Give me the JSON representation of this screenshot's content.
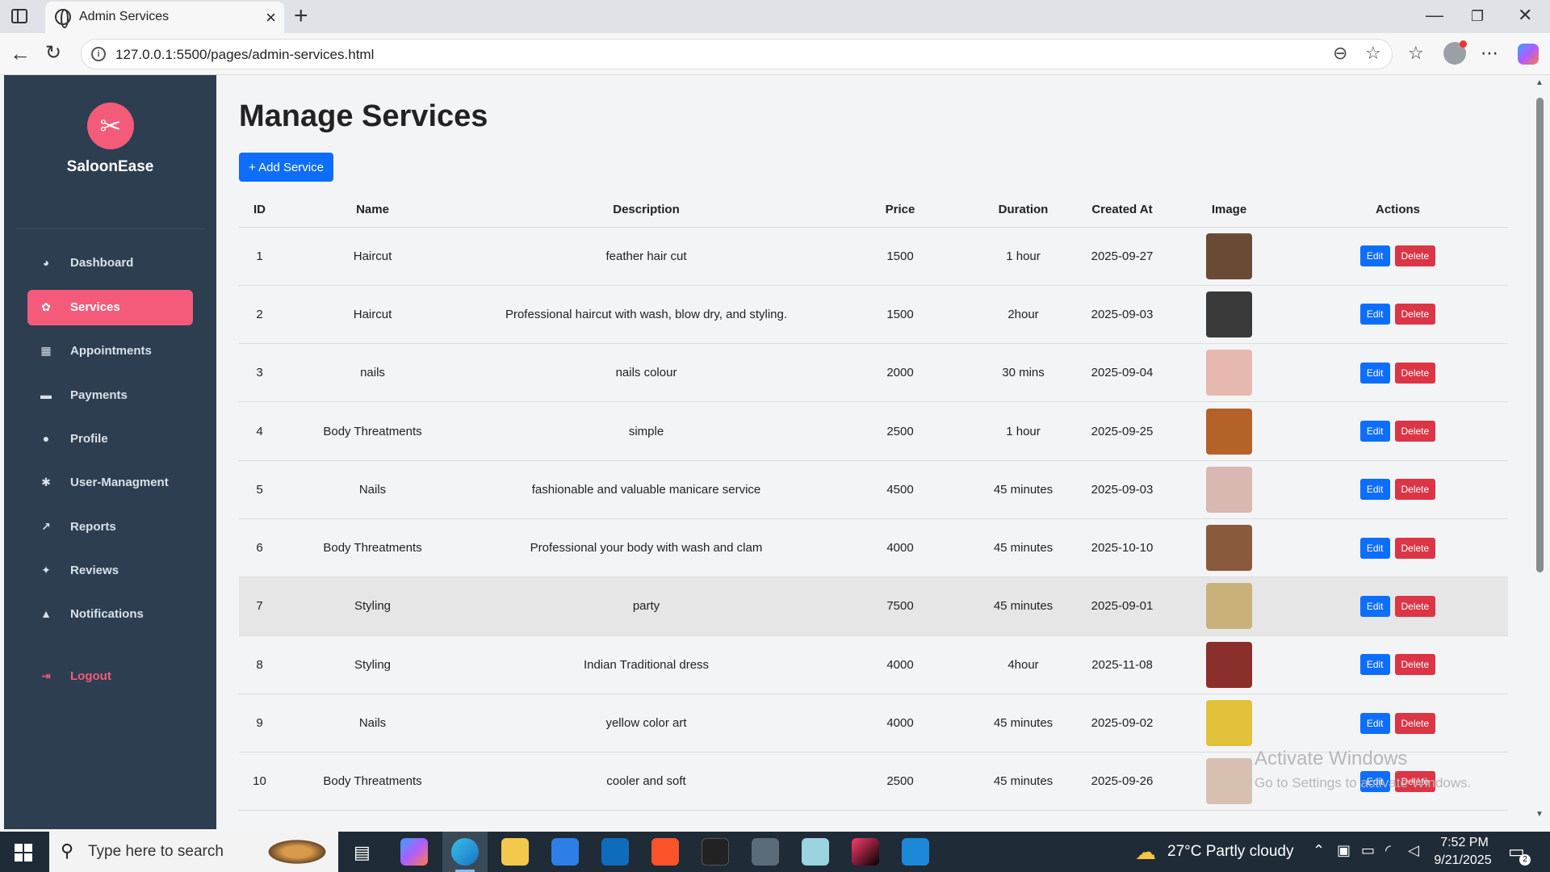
{
  "browser": {
    "tab_title": "Admin Services",
    "url": "127.0.0.1:5500/pages/admin-services.html"
  },
  "sidebar": {
    "brand": "SaloonEase",
    "items": [
      {
        "label": "Dashboard",
        "icon": "dashboard-icon",
        "glyph": "◕"
      },
      {
        "label": "Services",
        "icon": "scissors-icon",
        "glyph": "✿",
        "active": true
      },
      {
        "label": "Appointments",
        "icon": "calendar-icon",
        "glyph": "▦"
      },
      {
        "label": "Payments",
        "icon": "credit-card-icon",
        "glyph": "▬"
      },
      {
        "label": "Profile",
        "icon": "user-icon",
        "glyph": "●"
      },
      {
        "label": "User-Managment",
        "icon": "gear-icon",
        "glyph": "✱"
      },
      {
        "label": "Reports",
        "icon": "chart-icon",
        "glyph": "↗"
      },
      {
        "label": "Reviews",
        "icon": "users-icon",
        "glyph": "✦"
      },
      {
        "label": "Notifications",
        "icon": "bell-icon",
        "glyph": "▲"
      }
    ],
    "logout": "Logout"
  },
  "main": {
    "title": "Manage Services",
    "add_button": "+ Add Service",
    "columns": [
      "ID",
      "Name",
      "Description",
      "Price",
      "Duration",
      "Created At",
      "Image",
      "Actions"
    ],
    "rows": [
      {
        "id": "1",
        "name": "Haircut",
        "description": "feather hair cut",
        "price": "1500",
        "duration": "1 hour",
        "created_at": "2025-09-27",
        "thumb_color": "#6b4a35"
      },
      {
        "id": "2",
        "name": "Haircut",
        "description": "Professional haircut with wash, blow dry, and styling.",
        "price": "1500",
        "duration": "2hour",
        "created_at": "2025-09-03",
        "thumb_color": "#3a3a3a"
      },
      {
        "id": "3",
        "name": "nails",
        "description": "nails colour",
        "price": "2000",
        "duration": "30 mins",
        "created_at": "2025-09-04",
        "thumb_color": "#e6b8b0"
      },
      {
        "id": "4",
        "name": "Body Threatments",
        "description": "simple",
        "price": "2500",
        "duration": "1 hour",
        "created_at": "2025-09-25",
        "thumb_color": "#b5612a"
      },
      {
        "id": "5",
        "name": "Nails",
        "description": "fashionable and valuable manicare service",
        "price": "4500",
        "duration": "45 minutes",
        "created_at": "2025-09-03",
        "thumb_color": "#d9b8b2"
      },
      {
        "id": "6",
        "name": "Body Threatments",
        "description": "Professional your body with wash and clam",
        "price": "4000",
        "duration": "45 minutes",
        "created_at": "2025-10-10",
        "thumb_color": "#8a5a3c"
      },
      {
        "id": "7",
        "name": "Styling",
        "description": "party",
        "price": "7500",
        "duration": "45 minutes",
        "created_at": "2025-09-01",
        "thumb_color": "#c9b27a",
        "highlight": true
      },
      {
        "id": "8",
        "name": "Styling",
        "description": "Indian Traditional dress",
        "price": "4000",
        "duration": "4hour",
        "created_at": "2025-11-08",
        "thumb_color": "#8a2f2a"
      },
      {
        "id": "9",
        "name": "Nails",
        "description": "yellow color art",
        "price": "4000",
        "duration": "45 minutes",
        "created_at": "2025-09-02",
        "thumb_color": "#e2c23a"
      },
      {
        "id": "10",
        "name": "Body Threatments",
        "description": "cooler and soft",
        "price": "2500",
        "duration": "45 minutes",
        "created_at": "2025-09-26",
        "thumb_color": "#d8c0b0"
      }
    ],
    "edit_label": "Edit",
    "delete_label": "Delete"
  },
  "watermark": {
    "line1": "Activate Windows",
    "line2": "Go to Settings to activate Windows."
  },
  "taskbar": {
    "search_placeholder": "Type here to search",
    "weather": "27°C  Partly cloudy",
    "time": "7:52 PM",
    "date": "9/21/2025",
    "notification_count": "2"
  },
  "colors": {
    "sidebar_bg": "#2c3e50",
    "accent_pink": "#f45b7a",
    "primary_blue": "#0d6efd",
    "danger_red": "#dc3545"
  }
}
